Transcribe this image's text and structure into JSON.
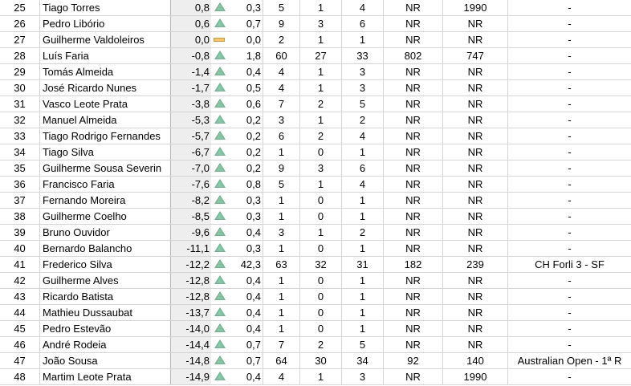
{
  "sheet": {
    "rows": [
      {
        "rank": "25",
        "name": "Tiago Torres",
        "points": "0,8",
        "trend": "up",
        "delta": "0,3",
        "played": "5",
        "wins": "1",
        "losses": "4",
        "rank1": "NR",
        "rank2": "1990",
        "last": "-"
      },
      {
        "rank": "26",
        "name": "Pedro Libório",
        "points": "0,6",
        "trend": "up",
        "delta": "0,7",
        "played": "9",
        "wins": "3",
        "losses": "6",
        "rank1": "NR",
        "rank2": "NR",
        "last": "-"
      },
      {
        "rank": "27",
        "name": "Guilherme Valdoleiros",
        "points": "0,0",
        "trend": "flat",
        "delta": "0,0",
        "played": "2",
        "wins": "1",
        "losses": "1",
        "rank1": "NR",
        "rank2": "NR",
        "last": "-"
      },
      {
        "rank": "28",
        "name": "Luís Faria",
        "points": "-0,8",
        "trend": "up",
        "delta": "1,8",
        "played": "60",
        "wins": "27",
        "losses": "33",
        "rank1": "802",
        "rank2": "747",
        "last": "-"
      },
      {
        "rank": "29",
        "name": "Tomás Almeida",
        "points": "-1,4",
        "trend": "up",
        "delta": "0,4",
        "played": "4",
        "wins": "1",
        "losses": "3",
        "rank1": "NR",
        "rank2": "NR",
        "last": "-"
      },
      {
        "rank": "30",
        "name": "José Ricardo Nunes",
        "points": "-1,7",
        "trend": "up",
        "delta": "0,5",
        "played": "4",
        "wins": "1",
        "losses": "3",
        "rank1": "NR",
        "rank2": "NR",
        "last": "-"
      },
      {
        "rank": "31",
        "name": "Vasco Leote Prata",
        "points": "-3,8",
        "trend": "up",
        "delta": "0,6",
        "played": "7",
        "wins": "2",
        "losses": "5",
        "rank1": "NR",
        "rank2": "NR",
        "last": "-"
      },
      {
        "rank": "32",
        "name": "Manuel Almeida",
        "points": "-5,3",
        "trend": "up",
        "delta": "0,2",
        "played": "3",
        "wins": "1",
        "losses": "2",
        "rank1": "NR",
        "rank2": "NR",
        "last": "-"
      },
      {
        "rank": "33",
        "name": "Tiago Rodrigo Fernandes",
        "points": "-5,7",
        "trend": "up",
        "delta": "0,2",
        "played": "6",
        "wins": "2",
        "losses": "4",
        "rank1": "NR",
        "rank2": "NR",
        "last": "-"
      },
      {
        "rank": "34",
        "name": "Tiago Silva",
        "points": "-6,7",
        "trend": "up",
        "delta": "0,2",
        "played": "1",
        "wins": "0",
        "losses": "1",
        "rank1": "NR",
        "rank2": "NR",
        "last": "-"
      },
      {
        "rank": "35",
        "name": "Guilherme Sousa Severin",
        "points": "-7,0",
        "trend": "up",
        "delta": "0,2",
        "played": "9",
        "wins": "3",
        "losses": "6",
        "rank1": "NR",
        "rank2": "NR",
        "last": "-"
      },
      {
        "rank": "36",
        "name": "Francisco Faria",
        "points": "-7,6",
        "trend": "up",
        "delta": "0,8",
        "played": "5",
        "wins": "1",
        "losses": "4",
        "rank1": "NR",
        "rank2": "NR",
        "last": "-"
      },
      {
        "rank": "37",
        "name": "Fernando Moreira",
        "points": "-8,2",
        "trend": "up",
        "delta": "0,3",
        "played": "1",
        "wins": "0",
        "losses": "1",
        "rank1": "NR",
        "rank2": "NR",
        "last": "-"
      },
      {
        "rank": "38",
        "name": "Guilherme Coelho",
        "points": "-8,5",
        "trend": "up",
        "delta": "0,3",
        "played": "1",
        "wins": "0",
        "losses": "1",
        "rank1": "NR",
        "rank2": "NR",
        "last": "-"
      },
      {
        "rank": "39",
        "name": "Bruno Ouvidor",
        "points": "-9,6",
        "trend": "up",
        "delta": "0,4",
        "played": "3",
        "wins": "1",
        "losses": "2",
        "rank1": "NR",
        "rank2": "NR",
        "last": "-"
      },
      {
        "rank": "40",
        "name": "Bernardo Balancho",
        "points": "-11,1",
        "trend": "up",
        "delta": "0,3",
        "played": "1",
        "wins": "0",
        "losses": "1",
        "rank1": "NR",
        "rank2": "NR",
        "last": "-"
      },
      {
        "rank": "41",
        "name": "Frederico Silva",
        "points": "-12,2",
        "trend": "up",
        "delta": "42,3",
        "played": "63",
        "wins": "32",
        "losses": "31",
        "rank1": "182",
        "rank2": "239",
        "last": "CH Forli 3 - SF"
      },
      {
        "rank": "42",
        "name": "Guilherme Alves",
        "points": "-12,8",
        "trend": "up",
        "delta": "0,4",
        "played": "1",
        "wins": "0",
        "losses": "1",
        "rank1": "NR",
        "rank2": "NR",
        "last": "-"
      },
      {
        "rank": "43",
        "name": "Ricardo Batista",
        "points": "-12,8",
        "trend": "up",
        "delta": "0,4",
        "played": "1",
        "wins": "0",
        "losses": "1",
        "rank1": "NR",
        "rank2": "NR",
        "last": "-"
      },
      {
        "rank": "44",
        "name": "Mathieu Dussaubat",
        "points": "-13,7",
        "trend": "up",
        "delta": "0,4",
        "played": "1",
        "wins": "0",
        "losses": "1",
        "rank1": "NR",
        "rank2": "NR",
        "last": "-"
      },
      {
        "rank": "45",
        "name": "Pedro Estevão",
        "points": "-14,0",
        "trend": "up",
        "delta": "0,4",
        "played": "1",
        "wins": "0",
        "losses": "1",
        "rank1": "NR",
        "rank2": "NR",
        "last": "-"
      },
      {
        "rank": "46",
        "name": "André Rodeia",
        "points": "-14,4",
        "trend": "up",
        "delta": "0,7",
        "played": "7",
        "wins": "2",
        "losses": "5",
        "rank1": "NR",
        "rank2": "NR",
        "last": "-"
      },
      {
        "rank": "47",
        "name": "João Sousa",
        "points": "-14,8",
        "trend": "up",
        "delta": "0,7",
        "played": "64",
        "wins": "30",
        "losses": "34",
        "rank1": "92",
        "rank2": "140",
        "last": "Australian Open - 1ª R"
      },
      {
        "rank": "48",
        "name": "Martim Leote Prata",
        "points": "-14,9",
        "trend": "up",
        "delta": "0,4",
        "played": "4",
        "wins": "1",
        "losses": "3",
        "rank1": "NR",
        "rank2": "1990",
        "last": "-"
      }
    ]
  },
  "icons": {
    "up": "triangle-up-icon",
    "flat": "flat-bar-icon"
  },
  "colors": {
    "up": "#6fae8f",
    "flat": "#f4c66a",
    "points_bg": "#eeeeee",
    "grid": "#d4d4d4"
  }
}
